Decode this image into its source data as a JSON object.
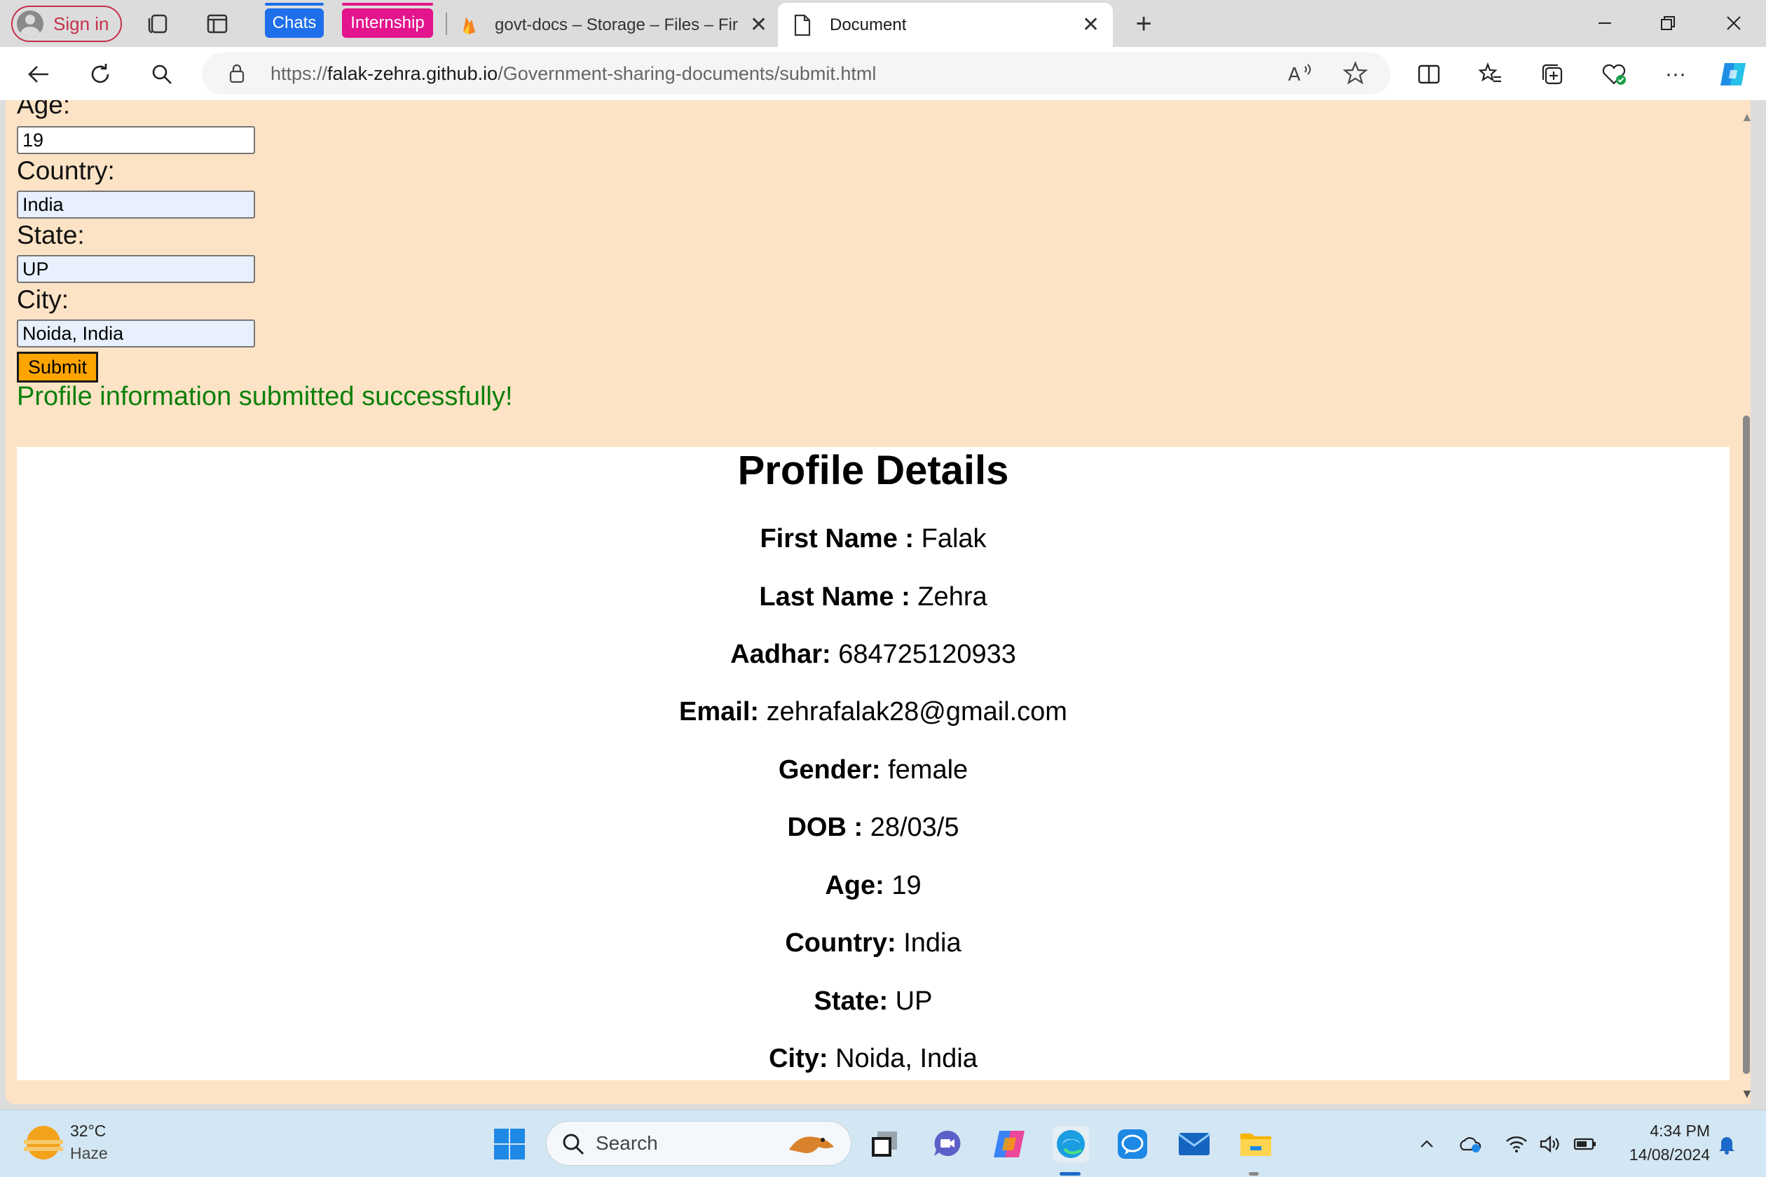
{
  "browser": {
    "signin_label": "Sign in",
    "tab_groups": [
      {
        "label": "Chats",
        "color": "#1f6feb"
      },
      {
        "label": "Internship",
        "color": "#e3148c"
      }
    ],
    "tabs": [
      {
        "title": "govt-docs – Storage – Files – Fire",
        "icon": "firebase-icon",
        "active": false
      },
      {
        "title": "Document",
        "icon": "document-icon",
        "active": true
      }
    ],
    "url_prefix": "https://",
    "url_host": "falak-zehra.github.io",
    "url_path": "/Government-sharing-documents/submit.html"
  },
  "form": {
    "age_label": "Age:",
    "age_value": "19",
    "country_label": "Country:",
    "country_value": "India",
    "state_label": "State:",
    "state_value": "UP",
    "city_label": "City:",
    "city_value": "Noida, India",
    "submit_label": "Submit",
    "success_message": "Profile information submitted successfully!"
  },
  "profile": {
    "title": "Profile Details",
    "rows": [
      {
        "label": "First Name :",
        "value": "Falak"
      },
      {
        "label": "Last Name :",
        "value": "Zehra"
      },
      {
        "label": "Aadhar:",
        "value": "684725120933"
      },
      {
        "label": "Email:",
        "value": "zehrafalak28@gmail.com"
      },
      {
        "label": "Gender:",
        "value": "female"
      },
      {
        "label": "DOB :",
        "value": "28/03/5"
      },
      {
        "label": "Age:",
        "value": "19"
      },
      {
        "label": "Country:",
        "value": "India"
      },
      {
        "label": "State:",
        "value": "UP"
      },
      {
        "label": "City:",
        "value": "Noida, India"
      }
    ]
  },
  "taskbar": {
    "temperature": "32°C",
    "condition": "Haze",
    "search_label": "Search",
    "time": "4:34 PM",
    "date": "14/08/2024"
  },
  "colors": {
    "page_background": "#fde3c5",
    "submit_button": "#ffa500",
    "success_text": "#0c800c"
  }
}
